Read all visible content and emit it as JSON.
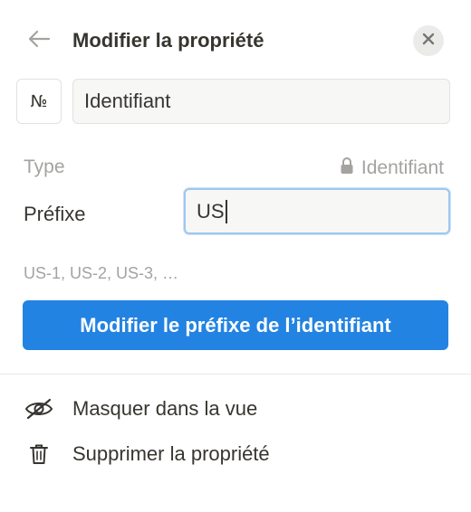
{
  "header": {
    "title": "Modifier la propriété",
    "back_icon": "arrow-left-icon",
    "close_icon": "close-icon"
  },
  "property": {
    "icon_glyph": "№",
    "name_value": "Identifiant"
  },
  "type": {
    "label": "Type",
    "value": "Identifiant",
    "lock_icon": "lock-icon"
  },
  "prefix": {
    "label": "Préfixe",
    "value": "US",
    "example": "US-1, US-2, US-3, …"
  },
  "primary_button": {
    "label": "Modifier le préfixe de l’identifiant",
    "color": "#2383e2"
  },
  "menu": [
    {
      "label": "Masquer dans la vue",
      "icon": "eye-slash-icon"
    },
    {
      "label": "Supprimer la propriété",
      "icon": "trash-icon"
    }
  ]
}
